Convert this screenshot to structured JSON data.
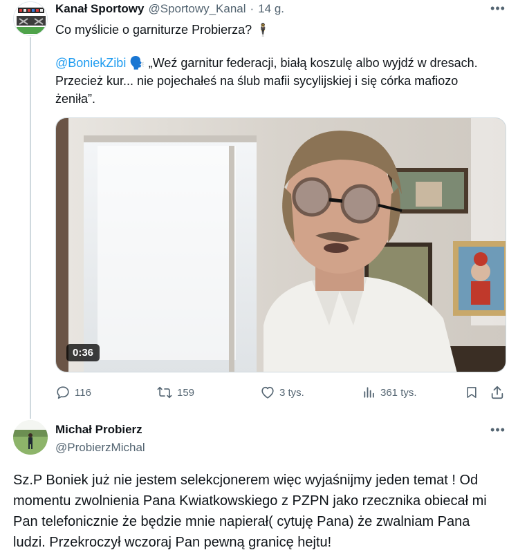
{
  "post1": {
    "author_name": "Kanał Sportowy",
    "author_handle": "@Sportowy_Kanal",
    "separator": "·",
    "time": "14 g.",
    "text": "Co myślicie o garniturze Probierza? 🕴",
    "quote_mention": "@BoniekZibi",
    "quote_text": " 🗣️ „Weź garnitur federacji, białą koszulę albo wyjdź w dresach. Przecież kur... nie pojechałeś na ślub mafii sycylijskiej i się córka mafiozo żeniła”.",
    "video_duration": "0:36",
    "stats": {
      "replies": "116",
      "reposts": "159",
      "likes": "3 tys.",
      "views": "361 tys."
    }
  },
  "post2": {
    "author_name": "Michał Probierz",
    "author_handle": "@ProbierzMichal",
    "text": "Sz.P Boniek już nie jestem selekcjonerem więc wyjaśnijmy jeden temat ! Od momentu zwolnienia Pana Kwiatkowskiego z PZPN jako rzecznika obiecał mi Pan telefonicznie że będzie mnie napierał( cytuję Pana) że zwalniam Pana ludzi. Przekroczył wczoraj Pan pewną granicę hejtu!"
  },
  "icons": {
    "more": "more-horizontal-icon",
    "reply": "reply-icon",
    "repost": "repost-icon",
    "like": "heart-icon",
    "views": "views-chart-icon",
    "bookmark": "bookmark-icon",
    "share": "share-icon"
  },
  "colors": {
    "text": "#0f1419",
    "secondary": "#536471",
    "mention": "#1d9bf0",
    "thread_line": "#cfd9de"
  }
}
